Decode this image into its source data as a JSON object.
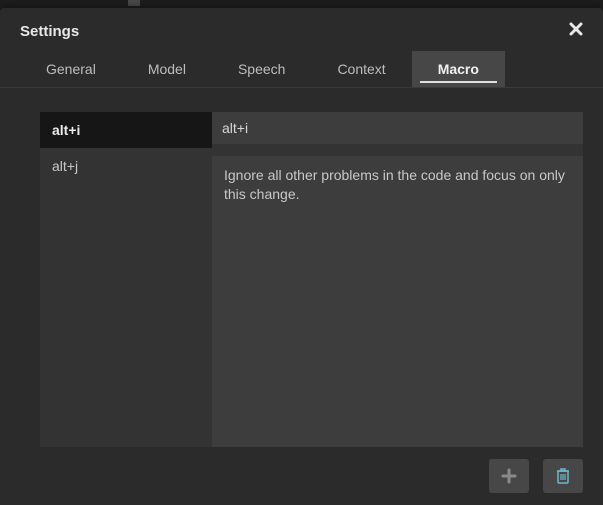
{
  "modal": {
    "title": "Settings"
  },
  "tabs": {
    "items": [
      {
        "label": "General"
      },
      {
        "label": "Model"
      },
      {
        "label": "Speech"
      },
      {
        "label": "Context"
      },
      {
        "label": "Macro"
      }
    ],
    "active_index": 4
  },
  "macros": {
    "list": [
      {
        "name": "alt+i"
      },
      {
        "name": "alt+j"
      }
    ],
    "selected_index": 0,
    "editor": {
      "name_value": "alt+i",
      "body_value": "Ignore all other problems in the code and focus on only this change."
    }
  },
  "icons": {
    "close": "close-icon",
    "add": "plus-icon",
    "delete": "trash-icon"
  },
  "colors": {
    "bg": "#2b2b2b",
    "panel": "#333333",
    "input": "#3d3d3d",
    "tab_active": "#474747",
    "trash_accent": "#6fb7c9"
  }
}
